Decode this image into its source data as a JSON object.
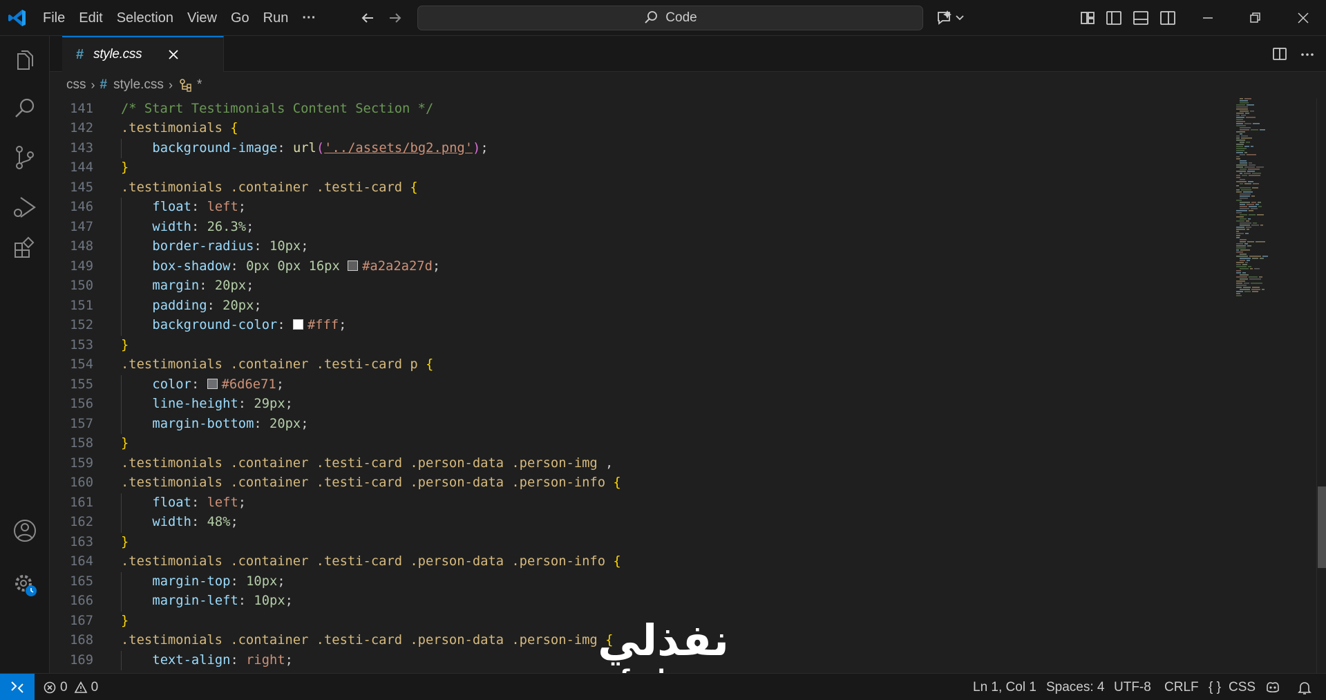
{
  "menu": [
    "File",
    "Edit",
    "Selection",
    "View",
    "Go",
    "Run",
    "···"
  ],
  "command_center": "Code",
  "tab": {
    "filename": "style.css"
  },
  "breadcrumb": {
    "folder": "css",
    "file": "style.css",
    "symbol": "*"
  },
  "editor": {
    "lines": [
      {
        "n": "141",
        "indent": 0,
        "tokens": [
          [
            "c-comment",
            "/* Start Testimonials Content Section */"
          ]
        ]
      },
      {
        "n": "142",
        "indent": 0,
        "tokens": [
          [
            "c-sel",
            ".testimonials"
          ],
          [
            "c-punc",
            " "
          ],
          [
            "c-brace",
            "{"
          ]
        ]
      },
      {
        "n": "143",
        "indent": 1,
        "tokens": [
          [
            "c-prop",
            "background-image"
          ],
          [
            "c-punc",
            ": "
          ],
          [
            "c-fn",
            "url"
          ],
          [
            "c-paren",
            "("
          ],
          [
            "c-str",
            "'../assets/bg2.png'"
          ],
          [
            "c-paren",
            ")"
          ],
          [
            "c-punc",
            ";"
          ]
        ]
      },
      {
        "n": "144",
        "indent": 0,
        "tokens": [
          [
            "c-brace",
            "}"
          ]
        ]
      },
      {
        "n": "145",
        "indent": 0,
        "tokens": [
          [
            "c-sel",
            ".testimonials .container .testi-card"
          ],
          [
            "c-punc",
            " "
          ],
          [
            "c-brace",
            "{"
          ]
        ]
      },
      {
        "n": "146",
        "indent": 1,
        "tokens": [
          [
            "c-prop",
            "float"
          ],
          [
            "c-punc",
            ": "
          ],
          [
            "c-val",
            "left"
          ],
          [
            "c-punc",
            ";"
          ]
        ]
      },
      {
        "n": "147",
        "indent": 1,
        "tokens": [
          [
            "c-prop",
            "width"
          ],
          [
            "c-punc",
            ": "
          ],
          [
            "c-num",
            "26.3%"
          ],
          [
            "c-punc",
            ";"
          ]
        ]
      },
      {
        "n": "148",
        "indent": 1,
        "tokens": [
          [
            "c-prop",
            "border-radius"
          ],
          [
            "c-punc",
            ": "
          ],
          [
            "c-num",
            "10px"
          ],
          [
            "c-punc",
            ";"
          ]
        ]
      },
      {
        "n": "149",
        "indent": 1,
        "tokens": [
          [
            "c-prop",
            "box-shadow"
          ],
          [
            "c-punc",
            ": "
          ],
          [
            "c-num",
            "0px"
          ],
          [
            "c-punc",
            " "
          ],
          [
            "c-num",
            "0px"
          ],
          [
            "c-punc",
            " "
          ],
          [
            "c-num",
            "16px"
          ],
          [
            "c-punc",
            " "
          ],
          [
            "swatch:#a2a2a27d",
            ""
          ],
          [
            "c-val",
            "#a2a2a27d"
          ],
          [
            "c-punc",
            ";"
          ]
        ]
      },
      {
        "n": "150",
        "indent": 1,
        "tokens": [
          [
            "c-prop",
            "margin"
          ],
          [
            "c-punc",
            ": "
          ],
          [
            "c-num",
            "20px"
          ],
          [
            "c-punc",
            ";"
          ]
        ]
      },
      {
        "n": "151",
        "indent": 1,
        "tokens": [
          [
            "c-prop",
            "padding"
          ],
          [
            "c-punc",
            ": "
          ],
          [
            "c-num",
            "20px"
          ],
          [
            "c-punc",
            ";"
          ]
        ]
      },
      {
        "n": "152",
        "indent": 1,
        "tokens": [
          [
            "c-prop",
            "background-color"
          ],
          [
            "c-punc",
            ": "
          ],
          [
            "swatch:#ffffff",
            ""
          ],
          [
            "c-val",
            "#fff"
          ],
          [
            "c-punc",
            ";"
          ]
        ]
      },
      {
        "n": "153",
        "indent": 0,
        "tokens": [
          [
            "c-brace",
            "}"
          ]
        ]
      },
      {
        "n": "154",
        "indent": 0,
        "tokens": [
          [
            "c-sel",
            ".testimonials .container .testi-card p"
          ],
          [
            "c-punc",
            " "
          ],
          [
            "c-brace",
            "{"
          ]
        ]
      },
      {
        "n": "155",
        "indent": 1,
        "tokens": [
          [
            "c-prop",
            "color"
          ],
          [
            "c-punc",
            ": "
          ],
          [
            "swatch:#6d6e71",
            ""
          ],
          [
            "c-val",
            "#6d6e71"
          ],
          [
            "c-punc",
            ";"
          ]
        ]
      },
      {
        "n": "156",
        "indent": 1,
        "tokens": [
          [
            "c-prop",
            "line-height"
          ],
          [
            "c-punc",
            ": "
          ],
          [
            "c-num",
            "29px"
          ],
          [
            "c-punc",
            ";"
          ]
        ]
      },
      {
        "n": "157",
        "indent": 1,
        "tokens": [
          [
            "c-prop",
            "margin-bottom"
          ],
          [
            "c-punc",
            ": "
          ],
          [
            "c-num",
            "20px"
          ],
          [
            "c-punc",
            ";"
          ]
        ]
      },
      {
        "n": "158",
        "indent": 0,
        "tokens": [
          [
            "c-brace",
            "}"
          ]
        ]
      },
      {
        "n": "159",
        "indent": 0,
        "tokens": [
          [
            "c-sel",
            ".testimonials .container .testi-card .person-data .person-img"
          ],
          [
            "c-punc",
            " ,"
          ]
        ]
      },
      {
        "n": "160",
        "indent": 0,
        "tokens": [
          [
            "c-sel",
            ".testimonials .container .testi-card .person-data .person-info"
          ],
          [
            "c-punc",
            " "
          ],
          [
            "c-brace",
            "{"
          ]
        ]
      },
      {
        "n": "161",
        "indent": 1,
        "tokens": [
          [
            "c-prop",
            "float"
          ],
          [
            "c-punc",
            ": "
          ],
          [
            "c-val",
            "left"
          ],
          [
            "c-punc",
            ";"
          ]
        ]
      },
      {
        "n": "162",
        "indent": 1,
        "tokens": [
          [
            "c-prop",
            "width"
          ],
          [
            "c-punc",
            ": "
          ],
          [
            "c-num",
            "48%"
          ],
          [
            "c-punc",
            ";"
          ]
        ]
      },
      {
        "n": "163",
        "indent": 0,
        "tokens": [
          [
            "c-brace",
            "}"
          ]
        ]
      },
      {
        "n": "164",
        "indent": 0,
        "tokens": [
          [
            "c-sel",
            ".testimonials .container .testi-card .person-data .person-info"
          ],
          [
            "c-punc",
            " "
          ],
          [
            "c-brace",
            "{"
          ]
        ]
      },
      {
        "n": "165",
        "indent": 1,
        "tokens": [
          [
            "c-prop",
            "margin-top"
          ],
          [
            "c-punc",
            ": "
          ],
          [
            "c-num",
            "10px"
          ],
          [
            "c-punc",
            ";"
          ]
        ]
      },
      {
        "n": "166",
        "indent": 1,
        "tokens": [
          [
            "c-prop",
            "margin-left"
          ],
          [
            "c-punc",
            ": "
          ],
          [
            "c-num",
            "10px"
          ],
          [
            "c-punc",
            ";"
          ]
        ]
      },
      {
        "n": "167",
        "indent": 0,
        "tokens": [
          [
            "c-brace",
            "}"
          ]
        ]
      },
      {
        "n": "168",
        "indent": 0,
        "tokens": [
          [
            "c-sel",
            ".testimonials .container .testi-card .person-data .person-img"
          ],
          [
            "c-punc",
            " "
          ],
          [
            "c-brace",
            "{"
          ]
        ]
      },
      {
        "n": "169",
        "indent": 1,
        "tokens": [
          [
            "c-prop",
            "text-align"
          ],
          [
            "c-punc",
            ": "
          ],
          [
            "c-val",
            "right"
          ],
          [
            "c-punc",
            ";"
          ]
        ]
      }
    ]
  },
  "watermark": {
    "arabic": "نفذلي",
    "latin": "nafezly.com"
  },
  "status": {
    "errors": "0",
    "warnings": "0",
    "position": "Ln 1, Col 1",
    "spaces": "Spaces: 4",
    "encoding": "UTF-8",
    "eol": "CRLF",
    "language": "CSS"
  },
  "colors": {
    "accent": "#0078d4",
    "background": "#1f1f1f",
    "chrome": "#181818"
  },
  "icons": [
    "vscode-logo-icon",
    "explorer-icon",
    "search-icon",
    "source-control-icon",
    "run-debug-icon",
    "extensions-icon",
    "account-icon",
    "settings-icon",
    "split-editor-icon",
    "more-actions-icon",
    "copilot-icon",
    "bell-icon",
    "remote-icon"
  ]
}
